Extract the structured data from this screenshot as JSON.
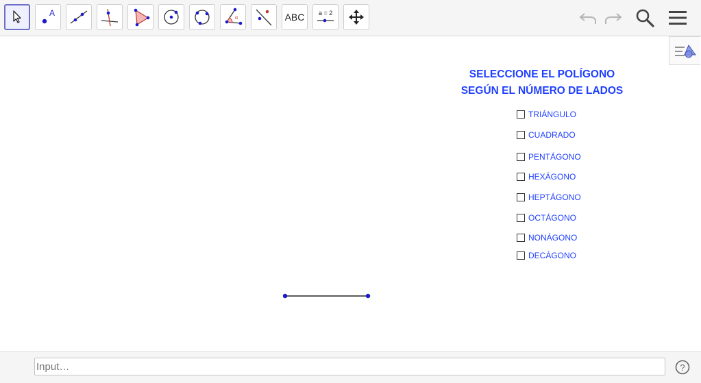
{
  "toolbar": {
    "tools": [
      {
        "name": "move-tool"
      },
      {
        "name": "point-tool"
      },
      {
        "name": "line-tool"
      },
      {
        "name": "perpendicular-line-tool"
      },
      {
        "name": "polygon-tool"
      },
      {
        "name": "circle-center-point-tool"
      },
      {
        "name": "circle-three-points-tool"
      },
      {
        "name": "angle-tool"
      },
      {
        "name": "reflect-tool"
      },
      {
        "name": "text-tool",
        "label": "ABC"
      },
      {
        "name": "slider-tool",
        "label": "a = 2"
      },
      {
        "name": "move-graphics-view-tool"
      }
    ],
    "right_buttons": [
      "undo-icon",
      "redo-icon",
      "search-icon",
      "menu-icon"
    ]
  },
  "graphics": {
    "heading_line1": "SELECCIONE EL POLÍGONO",
    "heading_line2": "SEGÚN EL NÚMERO DE LADOS",
    "options": [
      {
        "label": "TRIÁNGULO",
        "checked": false
      },
      {
        "label": "CUADRADO",
        "checked": false
      },
      {
        "label": "PENTÁGONO",
        "checked": false
      },
      {
        "label": "HEXÁGONO",
        "checked": false
      },
      {
        "label": "HEPTÁGONO",
        "checked": false
      },
      {
        "label": "OCTÁGONO",
        "checked": false
      },
      {
        "label": "NONÁGONO",
        "checked": false
      },
      {
        "label": "DECÁGONO",
        "checked": false
      }
    ],
    "accent_color": "#1f3fff",
    "point_color": "#1a1acc"
  },
  "input_bar": {
    "placeholder": "Input…",
    "value": ""
  }
}
